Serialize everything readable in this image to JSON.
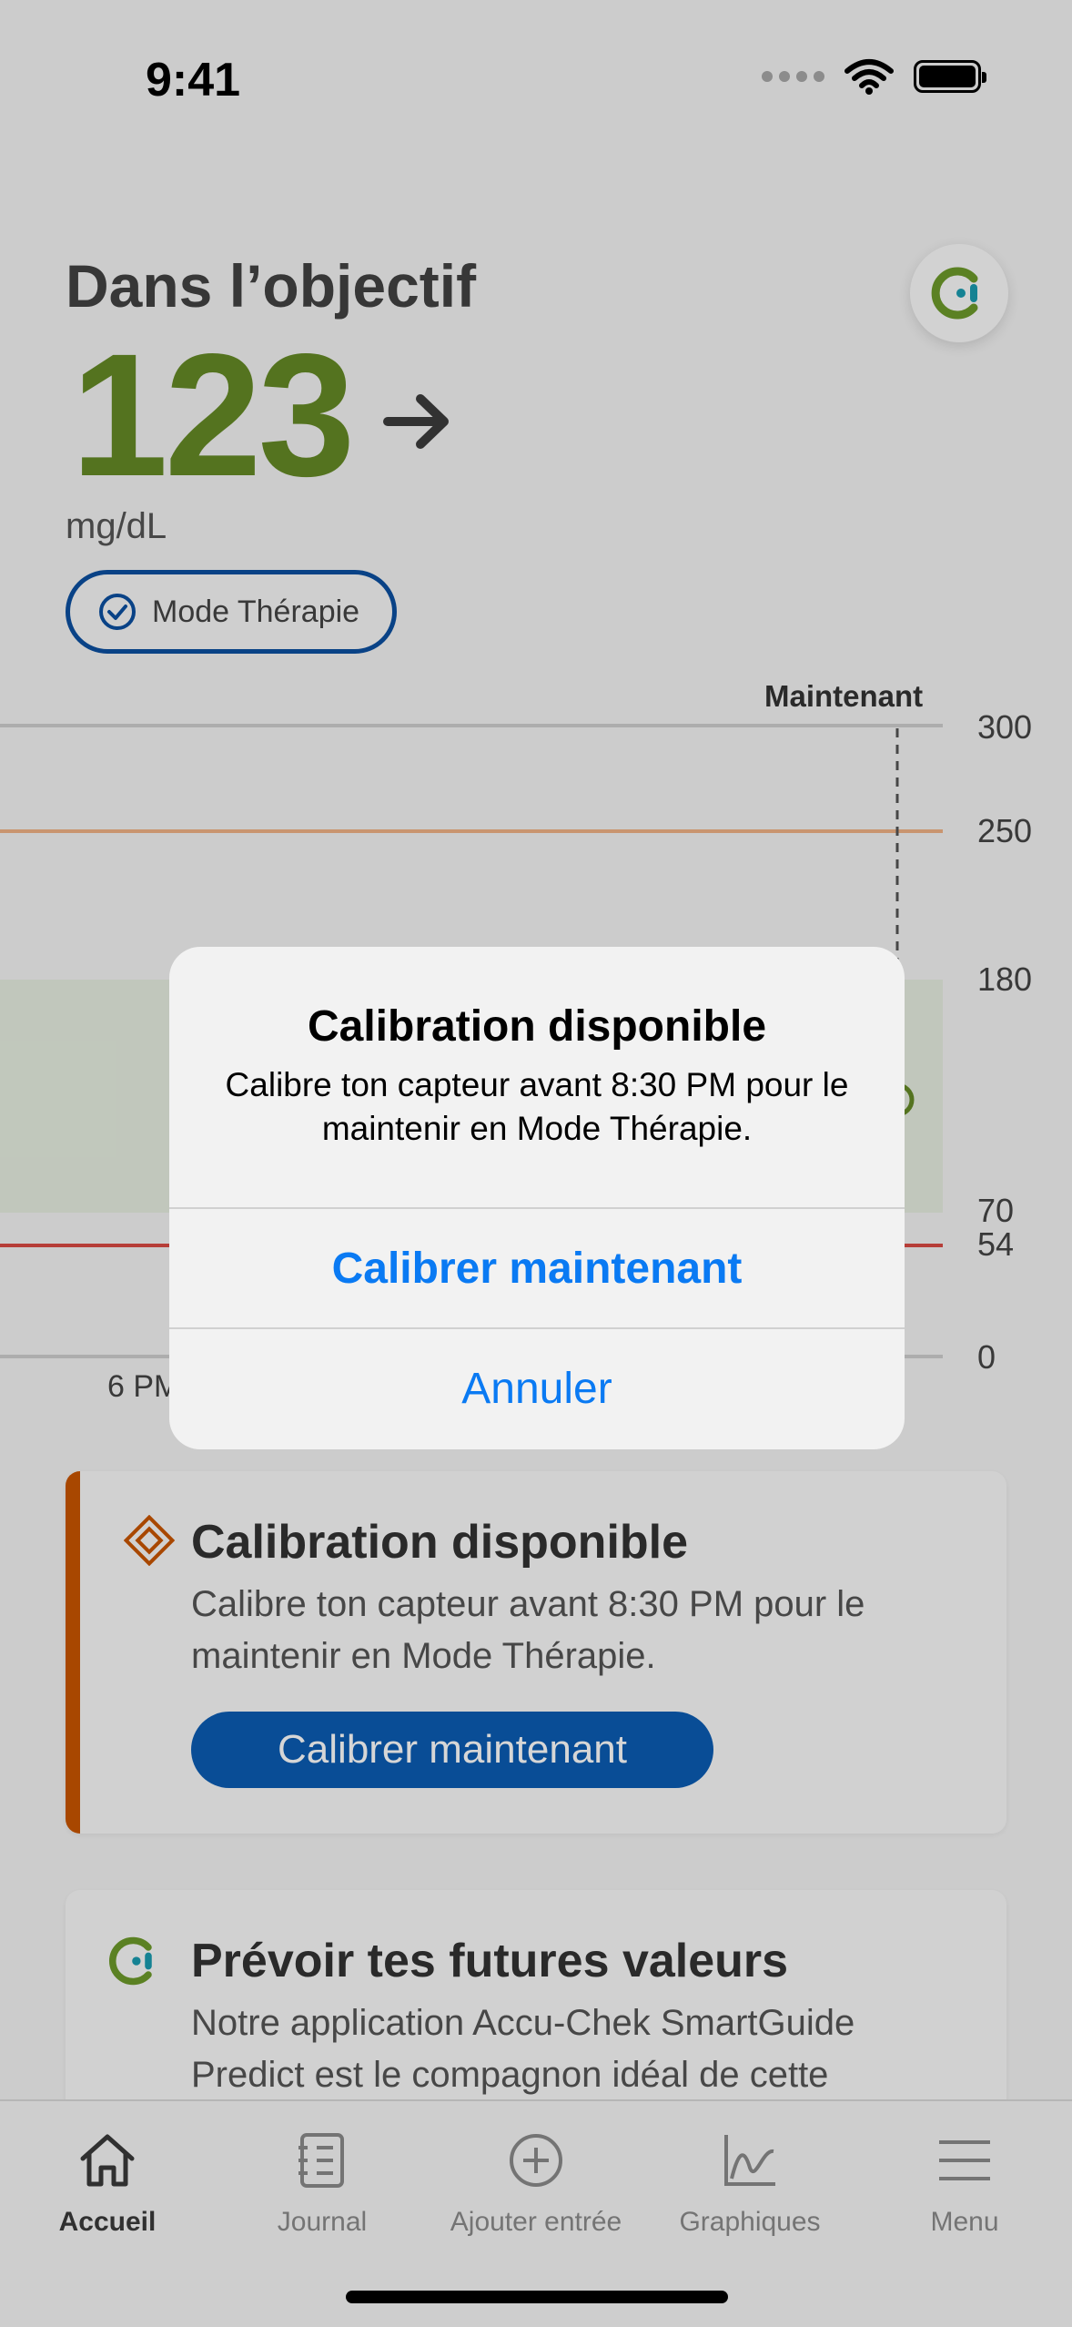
{
  "status_bar": {
    "time": "9:41"
  },
  "header": {
    "status": "Dans l’objectif",
    "value": "123",
    "unit": "mg/dL",
    "therapy_mode": "Mode Thérapie"
  },
  "chart": {
    "now_label": "Maintenant",
    "x_label_visible": "6 PM",
    "y_ticks": [
      "300",
      "250",
      "180",
      "70",
      "54",
      "0"
    ]
  },
  "chart_data": {
    "type": "line",
    "title": "",
    "xlabel": "",
    "ylabel": "",
    "x_ticks": [
      "6 PM"
    ],
    "y_ticks": [
      300,
      250,
      180,
      70,
      54,
      0
    ],
    "ylim": [
      0,
      300
    ],
    "target_range": [
      70,
      180
    ],
    "high_threshold": 250,
    "low_threshold": 54,
    "now_marker": "Maintenant",
    "colors": {
      "high": "#f0b285",
      "low": "#d94a43",
      "target_band": "#e6eee0",
      "point": "#658a26"
    }
  },
  "calibration_card": {
    "title": "Calibration disponible",
    "text": "Calibre ton capteur avant 8:30 PM pour le maintenir en Mode Thérapie.",
    "button": "Calibrer maintenant"
  },
  "predict_card": {
    "title": "Prévoir tes futures valeurs",
    "text": "Notre application Accu-Chek SmartGuide Predict est le compagnon idéal de cette"
  },
  "dialog": {
    "title": "Calibration disponible",
    "message": "Calibre ton capteur avant 8:30 PM pour le maintenir en Mode Thérapie.",
    "primary_action": "Calibrer maintenant",
    "cancel_action": "Annuler"
  },
  "tabbar": {
    "items": [
      {
        "label": "Accueil",
        "icon": "home-icon"
      },
      {
        "label": "Journal",
        "icon": "journal-icon"
      },
      {
        "label": "Ajouter entrée",
        "icon": "add-icon"
      },
      {
        "label": "Graphiques",
        "icon": "graph-icon"
      },
      {
        "label": "Menu",
        "icon": "menu-icon"
      }
    ]
  },
  "colors": {
    "accent": "#0a7af3",
    "in_range": "#658a26",
    "warning": "#c95500",
    "primary_button": "#0b5cb3"
  }
}
